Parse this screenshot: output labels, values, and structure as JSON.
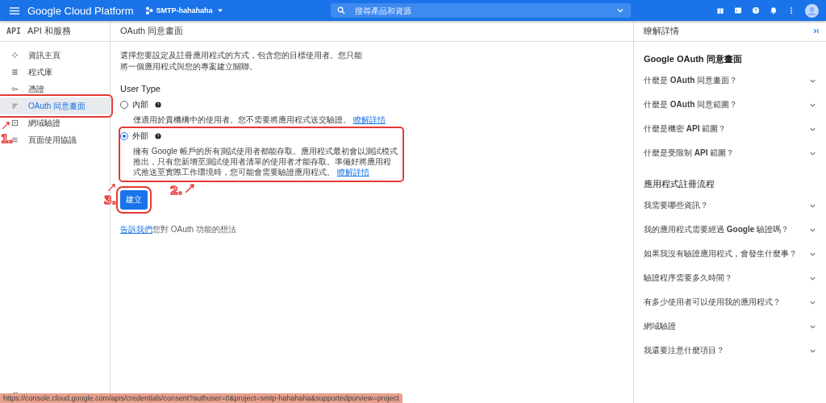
{
  "topbar": {
    "product": "Google Cloud Platform",
    "project": "SMTP-hahahaha",
    "search_placeholder": "搜尋產品和資源"
  },
  "sidebar": {
    "logo": "API",
    "title": "API 和服務",
    "items": [
      {
        "label": "資訊主頁",
        "selected": false,
        "outlined": false
      },
      {
        "label": "程式庫",
        "selected": false,
        "outlined": false
      },
      {
        "label": "憑證",
        "selected": false,
        "outlined": false
      },
      {
        "label": "OAuth 同意畫面",
        "selected": true,
        "outlined": true
      },
      {
        "label": "網域驗證",
        "selected": false,
        "outlined": false
      },
      {
        "label": "頁面使用協議",
        "selected": false,
        "outlined": false
      }
    ]
  },
  "main": {
    "title": "OAuth 同意畫面",
    "intro": "選擇您要設定及註冊應用程式的方式，包含您的目標使用者。您只能將一個應用程式與您的專案建立關聯。",
    "user_type_heading": "User Type",
    "options": [
      {
        "label": "內部",
        "selected": false,
        "outlined": false,
        "description": "僅適用於貴機構中的使用者。您不需要將應用程式送交驗證。",
        "link": "瞭解詳情"
      },
      {
        "label": "外部",
        "selected": true,
        "outlined": true,
        "description": "擁有 Google 帳戶的所有測試使用者都能存取。應用程式最初會以測試模式推出，只有您新增至測試使用者清單的使用者才能存取。準備好將應用程式推送至實際工作環境時，您可能會需要驗證應用程式。",
        "link": "瞭解詳情"
      }
    ],
    "create_button": {
      "label": "建立",
      "outlined": true
    },
    "feedback": {
      "link": "告訴我們",
      "text": "您對 OAuth 功能的想法"
    }
  },
  "help": {
    "title": "瞭解詳情",
    "sections": [
      {
        "heading": "Google OAuth 同意畫面",
        "items": [
          {
            "text": "什麼是 **OAuth** 同意畫面？",
            "expanded": false
          },
          {
            "text": "什麼是 **OAuth** 同意範圍？",
            "expanded": false
          },
          {
            "text": "什麼是機密 **API** 範圍？",
            "expanded": false
          },
          {
            "text": "什麼是受限制 **API** 範圍？",
            "expanded": false
          }
        ]
      },
      {
        "heading": "應用程式註冊流程",
        "items": [
          {
            "text": "我需要哪些資訊？",
            "expanded": false
          },
          {
            "text": "我的應用程式需要經過 **Google** 驗證嗎？",
            "expanded": false
          },
          {
            "text": "如果我沒有驗證應用程式，會發生什麼事？",
            "expanded": false
          },
          {
            "text": "驗證程序需要多久時間？",
            "expanded": false
          },
          {
            "text": "有多少使用者可以使用我的應用程式？",
            "expanded": false
          },
          {
            "text": "網域驗證",
            "expanded": false
          },
          {
            "text": "我還要注意什麼項目？",
            "expanded": false
          }
        ]
      }
    ]
  },
  "status_url": "https://console.cloud.google.com/apis/credentials/consent?authuser=0&project=smtp-hahahaha&supportedpurview=project",
  "annotations": [
    {
      "label": "1."
    },
    {
      "label": "2."
    },
    {
      "label": "3."
    }
  ]
}
